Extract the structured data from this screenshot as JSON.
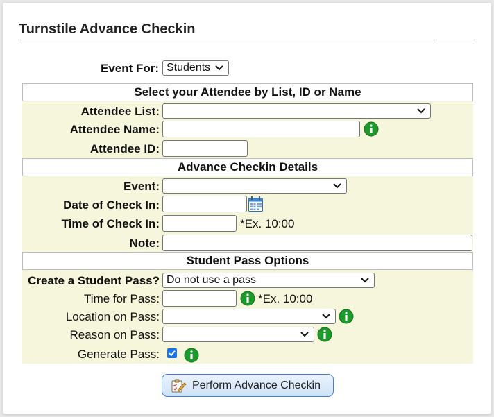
{
  "page": {
    "title": "Turnstile Advance Checkin"
  },
  "event_for": {
    "label": "Event For:",
    "selected": "Students"
  },
  "sections": {
    "attendee": "Select your Attendee by List, ID or Name",
    "details": "Advance Checkin Details",
    "pass": "Student Pass Options"
  },
  "attendee": {
    "list_label": "Attendee List:",
    "list_selected": "",
    "name_label": "Attendee Name:",
    "name_value": "",
    "id_label": "Attendee ID:",
    "id_value": ""
  },
  "details": {
    "event_label": "Event:",
    "event_selected": "",
    "date_label": "Date of Check In:",
    "date_value": "",
    "time_label": "Time of Check In:",
    "time_value": "",
    "time_hint": "*Ex. 10:00",
    "note_label": "Note:",
    "note_value": ""
  },
  "pass": {
    "create_label": "Create a Student Pass?",
    "create_selected": "Do not use a pass",
    "time_label": "Time for Pass:",
    "time_value": "",
    "time_hint": "*Ex. 10:00",
    "location_label": "Location on Pass:",
    "location_selected": "",
    "reason_label": "Reason on Pass:",
    "reason_selected": "",
    "generate_label": "Generate Pass:",
    "generate_checked": true
  },
  "actions": {
    "perform_label": "Perform Advance Checkin"
  },
  "colors": {
    "band": "#f5f6dc",
    "info_icon": "#1e9a2c",
    "checkbox": "#1a73e8",
    "button_border": "#3f7fd0"
  },
  "icons": {
    "info": "info-icon",
    "calendar": "calendar-icon",
    "perform": "checklist-pencil-icon"
  }
}
